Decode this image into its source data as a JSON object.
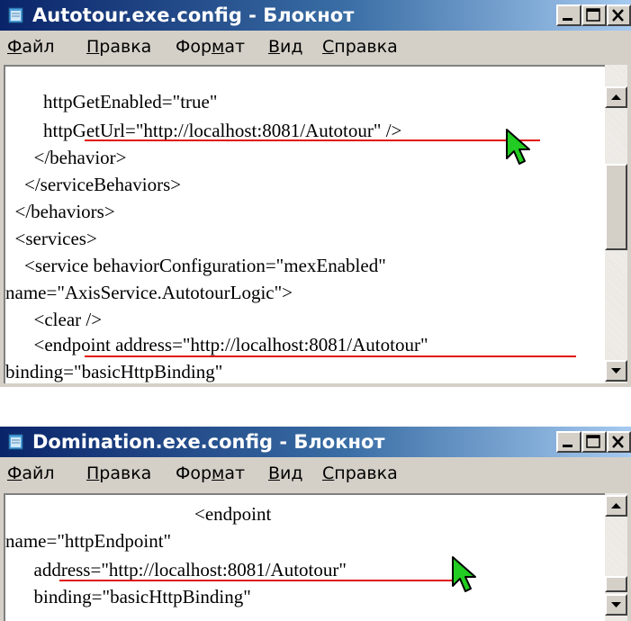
{
  "window1": {
    "title": "Autotour.exe.config - Блокнот",
    "menu": [
      {
        "pre": "",
        "ul": "Ф",
        "post": "айл"
      },
      {
        "pre": "",
        "ul": "П",
        "post": "равка"
      },
      {
        "pre": "Фор",
        "ul": "м",
        "post": "ат"
      },
      {
        "pre": "",
        "ul": "В",
        "post": "ид"
      },
      {
        "pre": "",
        "ul": "С",
        "post": "правка"
      }
    ],
    "lines": [
      "        httpGetEnabled=\"true\"",
      "        httpGetUrl=\"http://localhost:8081/Autotour\" />",
      "      </behavior>",
      "    </serviceBehaviors>",
      "  </behaviors>",
      "  <services>",
      "    <service behaviorConfiguration=\"mexEnabled\"",
      "name=\"AxisService.AutotourLogic\">",
      "      <clear />",
      "      <endpoint address=\"http://localhost:8081/Autotour\"",
      "binding=\"basicHttpBinding\""
    ]
  },
  "window2": {
    "title": "Domination.exe.config - Блокнот",
    "menu": [
      {
        "pre": "",
        "ul": "Ф",
        "post": "айл"
      },
      {
        "pre": "",
        "ul": "П",
        "post": "равка"
      },
      {
        "pre": "Фор",
        "ul": "м",
        "post": "ат"
      },
      {
        "pre": "",
        "ul": "В",
        "post": "ид"
      },
      {
        "pre": "",
        "ul": "С",
        "post": "правка"
      }
    ],
    "lines": [
      "                                        <endpoint",
      "name=\"httpEndpoint\"",
      "      address=\"http://localhost:8081/Autotour\"",
      "      binding=\"basicHttpBinding\""
    ]
  },
  "colors": {
    "highlight_underline": "#e01010",
    "cursor": "#22cc22"
  }
}
